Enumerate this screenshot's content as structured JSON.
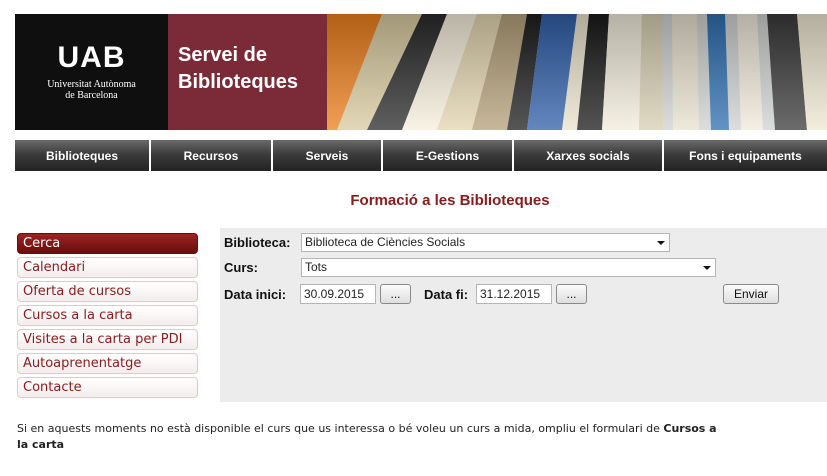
{
  "header": {
    "logo_mark": "UAB",
    "logo_sub_line1": "Universitat Autònoma",
    "logo_sub_line2": "de Barcelona",
    "service_line1": "Servei de",
    "service_line2": "Biblioteques"
  },
  "nav": {
    "items": [
      {
        "label": "Biblioteques"
      },
      {
        "label": "Recursos"
      },
      {
        "label": "Serveis"
      },
      {
        "label": "E-Gestions"
      },
      {
        "label": "Xarxes socials"
      },
      {
        "label": "Fons i equipaments"
      }
    ]
  },
  "page_title": "Formació a les Biblioteques",
  "sidebar": {
    "items": [
      {
        "label": "Cerca"
      },
      {
        "label": "Calendari"
      },
      {
        "label": "Oferta de cursos"
      },
      {
        "label": "Cursos a la carta"
      },
      {
        "label": "Visites a la carta per PDI"
      },
      {
        "label": "Autoaprenentatge"
      },
      {
        "label": "Contacte"
      }
    ]
  },
  "form": {
    "biblioteca_label": "Biblioteca:",
    "biblioteca_value": "Biblioteca de Ciències Socials",
    "curs_label": "Curs:",
    "curs_value": "Tots",
    "data_inici_label": "Data inici:",
    "data_inici_value": "30.09.2015",
    "date_picker_label": "...",
    "data_fi_label": "Data fi:",
    "data_fi_value": "31.12.2015",
    "enviar_label": "Enviar"
  },
  "note": {
    "text": "Si en aquests moments no està disponible el curs que us interessa o bé voleu un curs a mida, ompliu el formulari de ",
    "link": "Cursos a la carta"
  },
  "colors": {
    "accent": "#8b1a1a",
    "service_bg": "#7b2b37",
    "nav_bg": "#2e2e2e"
  }
}
